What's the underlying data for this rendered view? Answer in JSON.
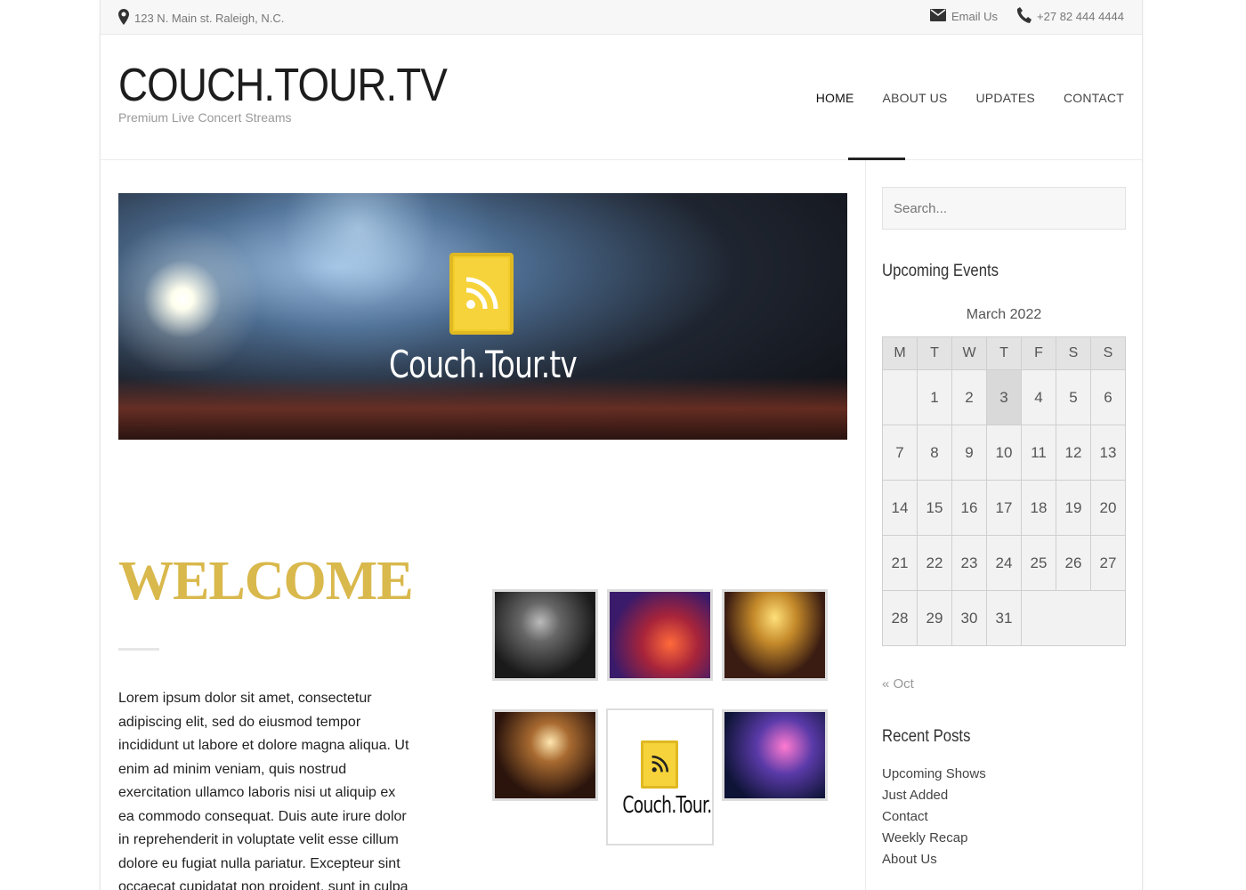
{
  "topbar": {
    "address": "123 N. Main st. Raleigh, N.C.",
    "email_label": "Email Us",
    "phone": "+27 82 444 4444"
  },
  "header": {
    "site_title": "COUCH.TOUR.TV",
    "tagline": "Premium Live Concert Streams",
    "nav": [
      "HOME",
      "ABOUT US",
      "UPDATES",
      "CONTACT"
    ],
    "active_nav": "HOME"
  },
  "hero": {
    "brand_text": "Couch.Tour.tv"
  },
  "main": {
    "welcome_heading": "WELCOME",
    "body_text": "Lorem ipsum dolor sit amet, consectetur adipiscing elit, sed do eiusmod tempor incididunt ut labore et dolore magna aliqua. Ut enim ad minim veniam, quis nostrud exercitation ullamco laboris nisi ut aliquip ex ea commodo consequat. Duis aute irure dolor in reprehenderit in voluptate velit esse cillum dolore eu fugiat nulla pariatur. Excepteur sint occaecat cupidatat non proident, sunt in culpa qui officia deserunt mollit anim id est laborum.",
    "gallery_brand_text": "Couch.Tour.tv"
  },
  "sidebar": {
    "search_placeholder": "Search...",
    "events_title": "Upcoming Events",
    "calendar": {
      "caption": "March 2022",
      "weekdays": [
        "M",
        "T",
        "W",
        "T",
        "F",
        "S",
        "S"
      ],
      "weeks": [
        [
          "",
          "1",
          "2",
          "3",
          "4",
          "5",
          "6"
        ],
        [
          "7",
          "8",
          "9",
          "10",
          "11",
          "12",
          "13"
        ],
        [
          "14",
          "15",
          "16",
          "17",
          "18",
          "19",
          "20"
        ],
        [
          "21",
          "22",
          "23",
          "24",
          "25",
          "26",
          "27"
        ],
        [
          "28",
          "29",
          "30",
          "31",
          "",
          "",
          ""
        ]
      ],
      "highlighted_day": "3",
      "prev_link": "« Oct"
    },
    "recent_posts_title": "Recent Posts",
    "recent_posts": [
      "Upcoming Shows",
      "Just Added",
      "Contact",
      "Weekly Recap",
      "About Us"
    ]
  }
}
